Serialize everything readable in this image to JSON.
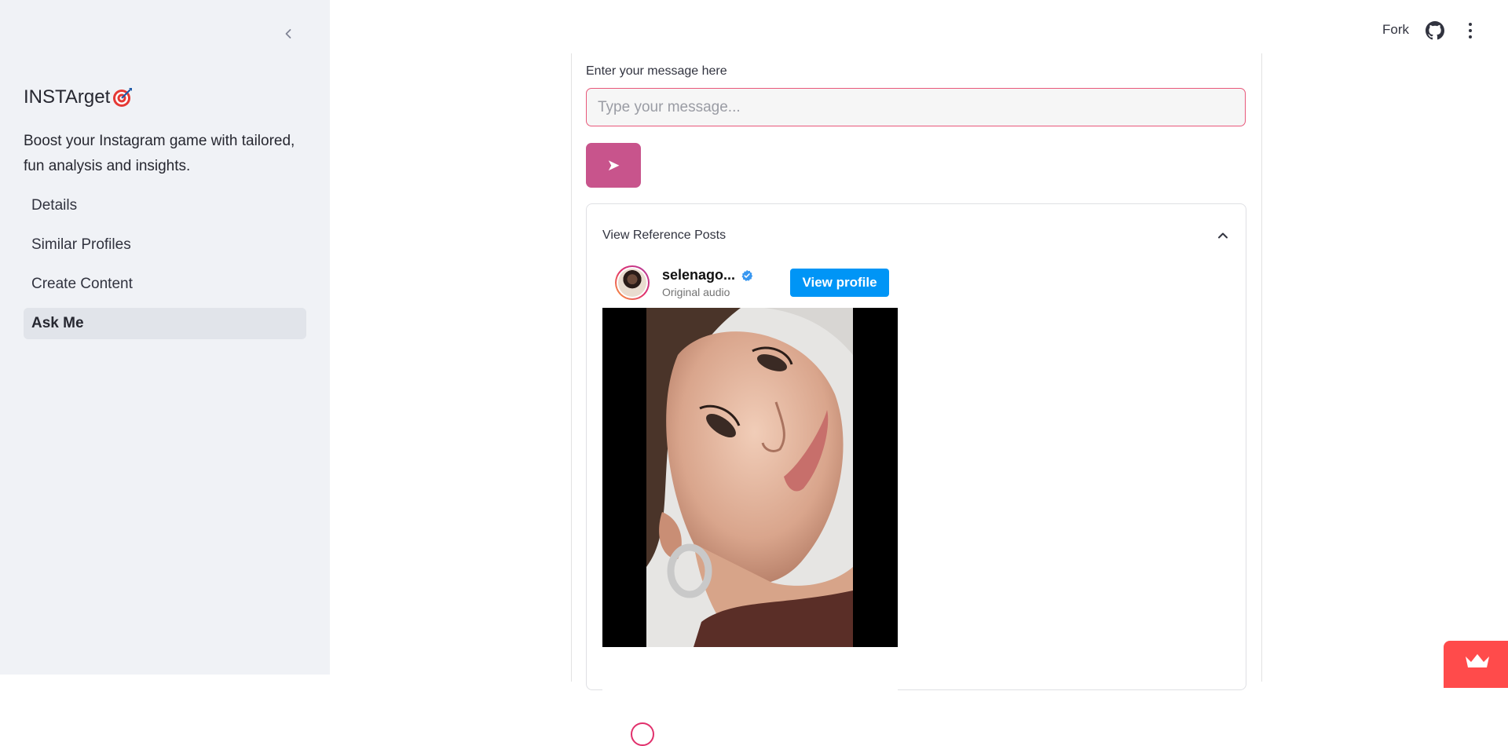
{
  "sidebar": {
    "app_title": "INSTArget",
    "description": "Boost your Instagram game with tailored, fun analysis and insights.",
    "nav_items": [
      {
        "label": "Details",
        "active": false
      },
      {
        "label": "Similar Profiles",
        "active": false
      },
      {
        "label": "Create Content",
        "active": false
      },
      {
        "label": "Ask Me",
        "active": true
      }
    ],
    "collapse_icon": "chevron-left-icon"
  },
  "header": {
    "fork_label": "Fork",
    "github_icon": "github-icon",
    "menu_icon": "more-vertical-icon"
  },
  "chat": {
    "input_label": "Enter your message here",
    "input_placeholder": "Type your message...",
    "input_value": "",
    "send_label": "➤"
  },
  "expander": {
    "title": "View Reference Posts",
    "expanded": true
  },
  "instagram_post": {
    "username": "selenago...",
    "subtitle": "Original audio",
    "verified": true,
    "view_profile_label": "View profile"
  },
  "colors": {
    "sidebar_bg": "#f0f2f6",
    "accent_pink": "#c8548c",
    "input_border": "#e8587a",
    "instagram_blue": "#0095f6",
    "streamlit_red": "#ff4b4b"
  }
}
